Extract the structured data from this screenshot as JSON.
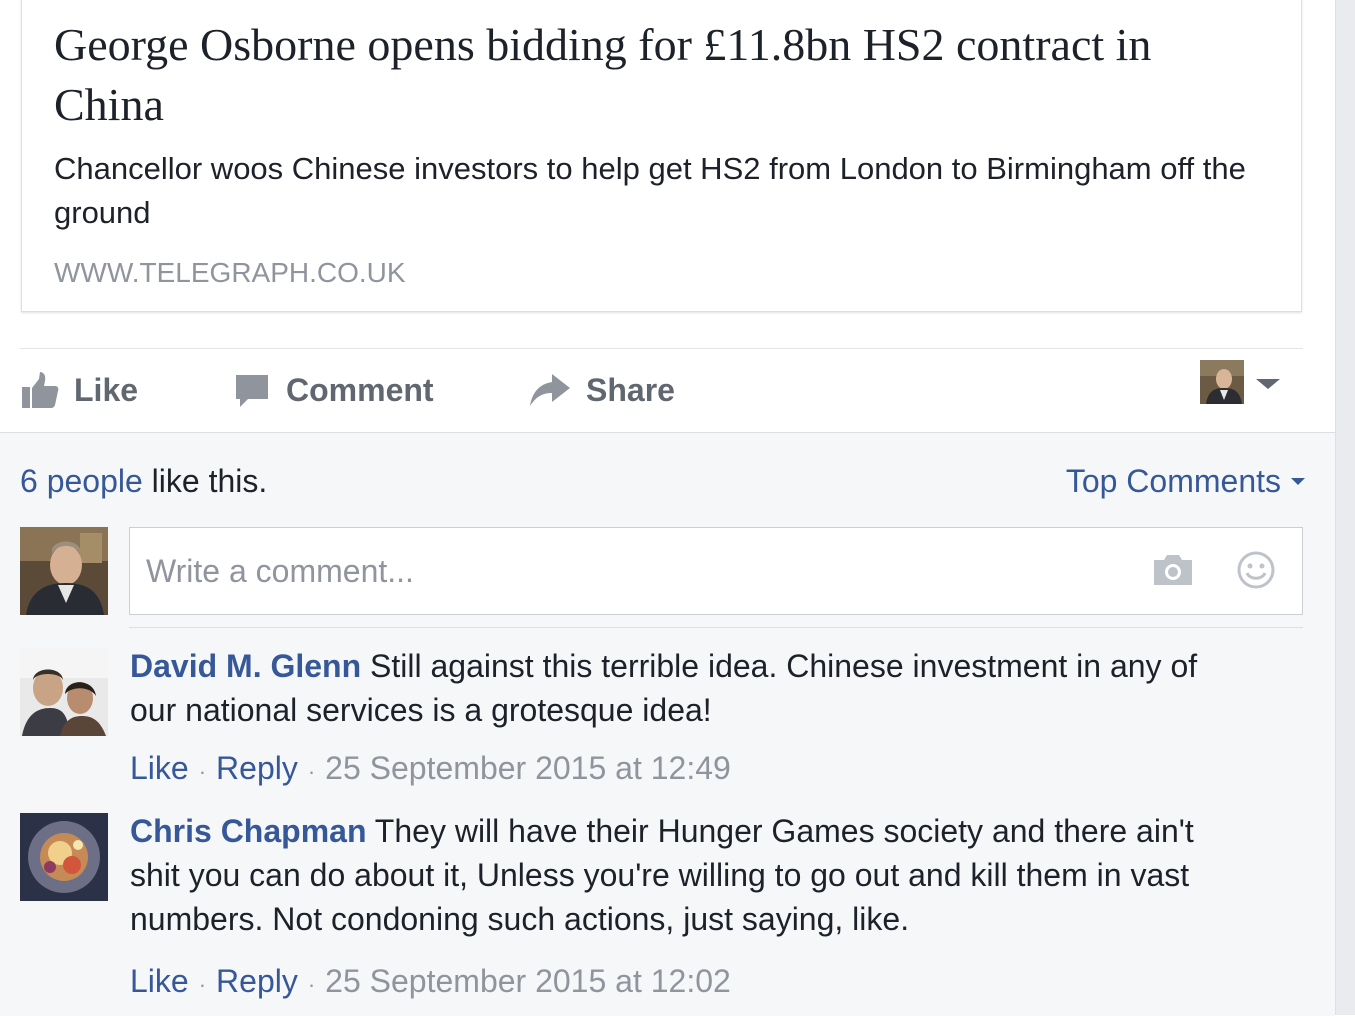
{
  "link_preview": {
    "title": "George Osborne opens bidding for £11.8bn HS2 contract in China",
    "description": "Chancellor woos Chinese investors to help get HS2 from London to Birmingham off the ground",
    "domain": "WWW.TELEGRAPH.CO.UK"
  },
  "actions": {
    "like": "Like",
    "comment": "Comment",
    "share": "Share"
  },
  "likes_summary": {
    "count": "6 people",
    "suffix": " like this."
  },
  "sort": {
    "label": "Top Comments"
  },
  "composer": {
    "placeholder": "Write a comment..."
  },
  "comments": [
    {
      "author": "David M. Glenn",
      "text": "Still against this terrible idea. Chinese investment in any of our national services is a grotesque idea!",
      "like": "Like",
      "reply": "Reply",
      "timestamp": "25 September 2015 at 12:49"
    },
    {
      "author": "Chris Chapman",
      "text": "They will have their Hunger Games society and there ain't shit you can do about it, Unless you're willing to go out and kill them in vast numbers. Not condoning such actions, just saying, like.",
      "like": "Like",
      "reply": "Reply",
      "timestamp": "25 September 2015 at 12:02"
    }
  ],
  "icons": {
    "like": "thumbs-up-icon",
    "comment": "speech-bubble-icon",
    "share": "share-arrow-icon",
    "camera": "camera-icon",
    "emoji": "smiley-icon",
    "dropdown": "chevron-down-icon"
  },
  "colors": {
    "link_blue": "#365899",
    "meta_gray": "#90949c",
    "action_gray": "#606770",
    "comments_bg": "#f6f7f9"
  }
}
